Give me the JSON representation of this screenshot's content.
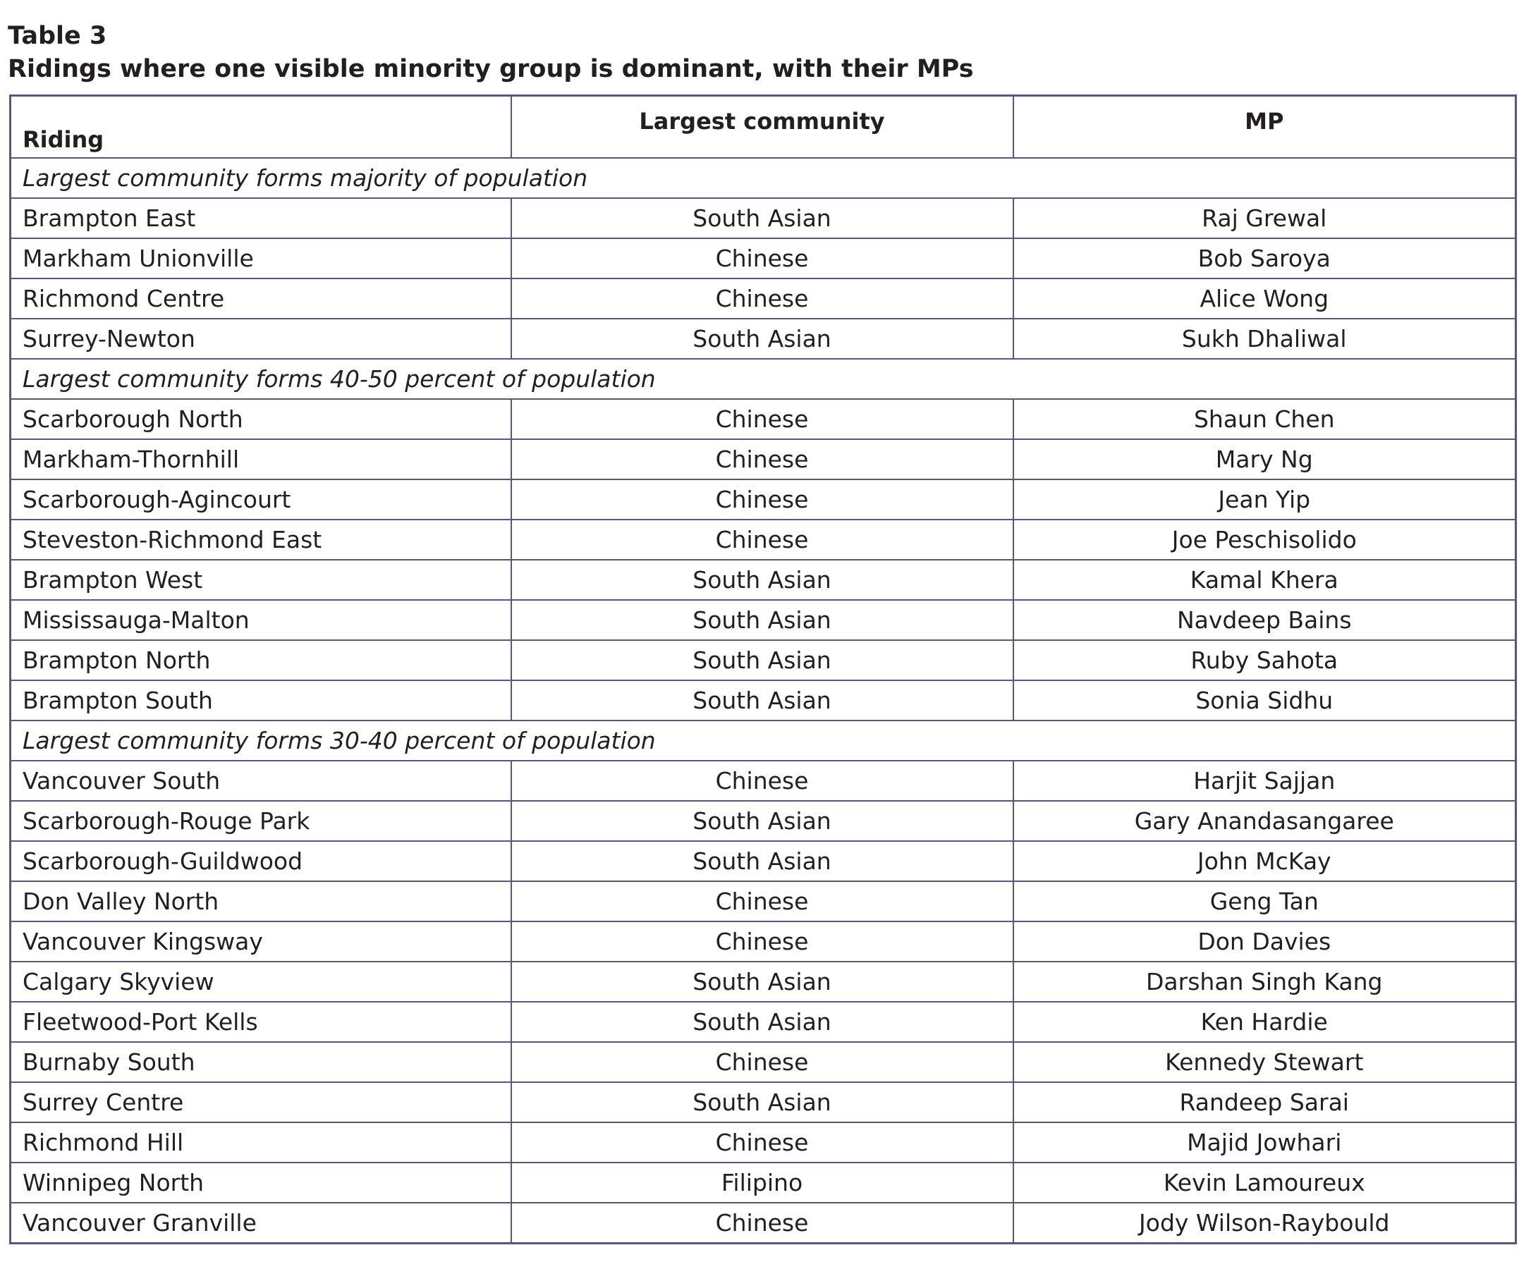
{
  "caption": {
    "label": "Table 3",
    "title": "Ridings where one visible minority group is dominant, with their MPs"
  },
  "columns": {
    "riding": "Riding",
    "community": "Largest community",
    "mp": "MP"
  },
  "sections": [
    {
      "heading": "Largest community forms majority of population",
      "rows": [
        {
          "riding": "Brampton East",
          "community": "South Asian",
          "mp": "Raj Grewal"
        },
        {
          "riding": "Markham Unionville",
          "community": "Chinese",
          "mp": "Bob Saroya"
        },
        {
          "riding": "Richmond Centre",
          "community": "Chinese",
          "mp": "Alice Wong"
        },
        {
          "riding": "Surrey-Newton",
          "community": "South Asian",
          "mp": "Sukh Dhaliwal"
        }
      ]
    },
    {
      "heading": "Largest community forms 40-50 percent of population",
      "rows": [
        {
          "riding": "Scarborough North",
          "community": "Chinese",
          "mp": "Shaun Chen"
        },
        {
          "riding": "Markham-Thornhill",
          "community": "Chinese",
          "mp": "Mary Ng"
        },
        {
          "riding": "Scarborough-Agincourt",
          "community": "Chinese",
          "mp": "Jean Yip"
        },
        {
          "riding": "Steveston-Richmond East",
          "community": "Chinese",
          "mp": "Joe Peschisolido"
        },
        {
          "riding": "Brampton West",
          "community": "South Asian",
          "mp": "Kamal Khera"
        },
        {
          "riding": "Mississauga-Malton",
          "community": "South Asian",
          "mp": "Navdeep Bains"
        },
        {
          "riding": "Brampton North",
          "community": "South Asian",
          "mp": "Ruby Sahota"
        },
        {
          "riding": "Brampton South",
          "community": "South Asian",
          "mp": "Sonia Sidhu"
        }
      ]
    },
    {
      "heading": "Largest community forms 30-40 percent of population",
      "rows": [
        {
          "riding": "Vancouver South",
          "community": "Chinese",
          "mp": "Harjit Sajjan"
        },
        {
          "riding": "Scarborough-Rouge Park",
          "community": "South Asian",
          "mp": "Gary Anandasangaree"
        },
        {
          "riding": "Scarborough-Guildwood",
          "community": "South Asian",
          "mp": "John McKay"
        },
        {
          "riding": "Don Valley North",
          "community": "Chinese",
          "mp": "Geng Tan"
        },
        {
          "riding": "Vancouver Kingsway",
          "community": "Chinese",
          "mp": "Don Davies"
        },
        {
          "riding": "Calgary Skyview",
          "community": "South Asian",
          "mp": "Darshan Singh Kang"
        },
        {
          "riding": "Fleetwood-Port Kells",
          "community": "South Asian",
          "mp": "Ken Hardie"
        },
        {
          "riding": "Burnaby South",
          "community": "Chinese",
          "mp": "Kennedy Stewart"
        },
        {
          "riding": "Surrey Centre",
          "community": "South Asian",
          "mp": "Randeep Sarai"
        },
        {
          "riding": "Richmond Hill",
          "community": "Chinese",
          "mp": "Majid Jowhari"
        },
        {
          "riding": "Winnipeg North",
          "community": "Filipino",
          "mp": "Kevin Lamoureux"
        },
        {
          "riding": "Vancouver Granville",
          "community": "Chinese",
          "mp": "Jody Wilson-Raybould"
        }
      ]
    }
  ]
}
